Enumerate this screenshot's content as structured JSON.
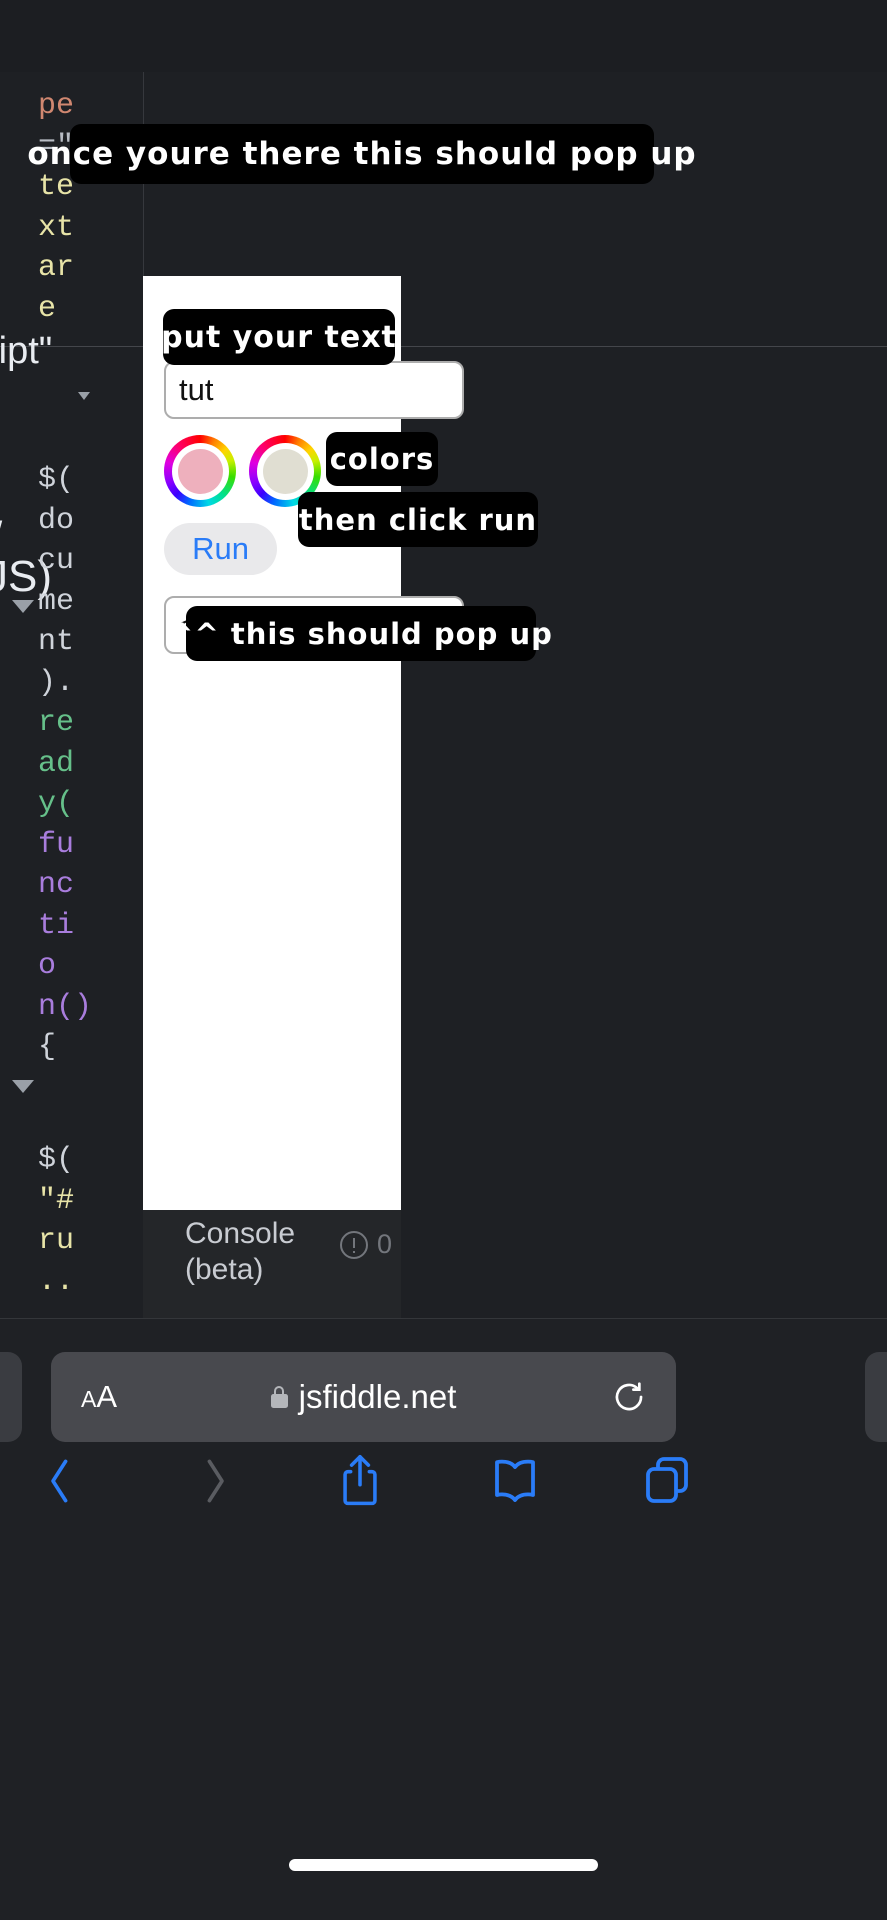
{
  "app": {
    "site": "jsfiddle.net",
    "theme_bg": "#1e2024",
    "panel_bg": "#ffffff",
    "accent": "#2a7cf7"
  },
  "editor": {
    "code_fragments": [
      {
        "name": "attr-type",
        "text": "pe",
        "token": "tag"
      },
      {
        "name": "attr-assign",
        "text": "=\"",
        "token": "op"
      },
      {
        "name": "value-te",
        "text": "te",
        "token": "str"
      },
      {
        "name": "value-xt",
        "text": "xt",
        "token": "str"
      },
      {
        "name": "value-ar",
        "text": "ar",
        "token": "str"
      },
      {
        "name": "value-e",
        "text": "e",
        "token": "str"
      },
      {
        "name": "value-cript",
        "text": "ript\"",
        "token": "str"
      }
    ],
    "fragment_cript": "ript\"",
    "fragment_slash": "/",
    "fragment_js": "JS)",
    "lines": [
      "$(",
      "do",
      "cu",
      "me",
      "nt",
      ").",
      "re",
      "ad",
      "y(",
      "fu",
      "nc",
      "ti",
      "o",
      "n()",
      "{"
    ],
    "lines_lower": [
      "$(",
      "\"#",
      "ru",
      ".."
    ]
  },
  "result_panel": {
    "text_input": {
      "value": "tut",
      "placeholder": "text"
    },
    "swatches": [
      {
        "name": "color-swatch-1",
        "color": "#eeb0bd"
      },
      {
        "name": "color-swatch-2",
        "color": "#e0ded2"
      }
    ],
    "run_label": "Run",
    "span_input": {
      "value": "<span style='col",
      "placeholder": "html"
    }
  },
  "console": {
    "label": "Console (beta)",
    "count": "0"
  },
  "annotations": [
    {
      "name": "annotation-popup-top",
      "text": "once youre there this should pop up"
    },
    {
      "name": "annotation-put-text",
      "text": "put your text"
    },
    {
      "name": "annotation-colors",
      "text": "colors"
    },
    {
      "name": "annotation-then-click-run",
      "text": "then click run"
    },
    {
      "name": "annotation-this-should-popup",
      "text": "^^ this should pop up"
    }
  ],
  "browser": {
    "aa_small": "A",
    "aa_large": "A",
    "url": "jsfiddle.net",
    "toolbar": [
      {
        "name": "back-button",
        "label": "Back"
      },
      {
        "name": "forward-button",
        "label": "Forward"
      },
      {
        "name": "share-button",
        "label": "Share"
      },
      {
        "name": "bookmarks-button",
        "label": "Bookmarks"
      },
      {
        "name": "tabs-button",
        "label": "Tabs"
      }
    ]
  }
}
